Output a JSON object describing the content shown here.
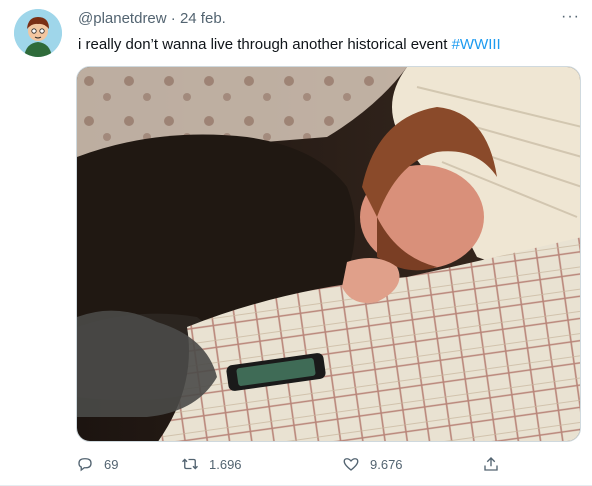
{
  "tweet": {
    "handle": "@planetdrew",
    "separator": "·",
    "date": "24 feb.",
    "text": "i really don’t wanna live through another historical event ",
    "hashtag": "#WWIII",
    "more_icon": "more-dots-icon"
  },
  "actions": {
    "replies": "69",
    "retweets": "1.696",
    "likes": "9.676"
  },
  "icons": [
    "reply-icon",
    "retweet-icon",
    "like-icon",
    "share-icon"
  ],
  "colors": {
    "accent": "#1d9bf0",
    "muted": "#536471",
    "text": "#0f1419"
  }
}
